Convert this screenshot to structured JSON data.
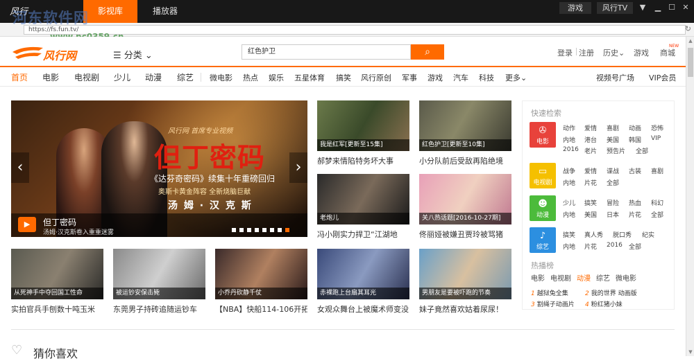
{
  "titlebar": {
    "logo": "风行",
    "tabs": [
      "影视库",
      "播放器"
    ],
    "active_tab": 0,
    "right_buttons": [
      "游戏",
      "风行TV"
    ],
    "controls": [
      "menu-arrow",
      "minimize",
      "maximize",
      "close"
    ]
  },
  "watermark": {
    "text": "河东软件网",
    "url": "www.pc0359.cn"
  },
  "address": {
    "url": "https://fs.fun.tv/"
  },
  "header": {
    "logo_text": "风行网",
    "category_label": "☰ 分类 ⌄",
    "search_value": "红色护卫",
    "search_button": "⌕",
    "links": [
      "登录",
      "注册",
      "历史⌄",
      "游戏",
      "商城"
    ],
    "new_badge": "NEW"
  },
  "nav": {
    "items": [
      "首页",
      "电影",
      "电视剧",
      "少儿",
      "动漫",
      "综艺"
    ],
    "small_items": [
      "微电影",
      "热点",
      "娱乐",
      "五星体育",
      "搞笑",
      "风行原创",
      "军事",
      "游戏",
      "汽车",
      "科技",
      "更多⌄"
    ],
    "right_items": [
      "视频号广场",
      "VIP会员"
    ],
    "active": 0
  },
  "banner": {
    "sub": "风行网 首席专业视频",
    "title": "但丁密码",
    "line1": "《达芬奇密码》续集十年重磅回归",
    "line2": "奥斯卡黄金阵容 全新烧脑巨献",
    "line3": "汤 姆 · 汉 克 斯",
    "caption_title": "但丁密码",
    "caption_sub": "汤姆·汉克斯卷入重重迷雾",
    "dot_count": 8,
    "active_dot": 7,
    "prev": "‹",
    "next": "›"
  },
  "tiles_top": [
    {
      "overlay": "我是红军[更新至15集]",
      "title": "郝梦来情陷特务坏大事"
    },
    {
      "overlay": "红色护卫[更新至10集]",
      "title": "小分队前后受敌再陷绝境"
    },
    {
      "overlay": "老炮儿",
      "title": "冯小刚实力捍卫“江湖地"
    },
    {
      "overlay": "关八热话题[2016-10-27期]",
      "title": "佟丽娅被嫌丑贾玲被骂猪"
    }
  ],
  "tiles_bottom": [
    {
      "overlay": "从死神手中夺回国工性命",
      "title": "实拍官兵手刨数十吨玉米"
    },
    {
      "overlay": "被运钞安保击毙",
      "title": "东莞男子持砖追随运钞车"
    },
    {
      "overlay": "小乔丹砍静千仗",
      "title": "【NBA】快船114-106开拓"
    },
    {
      "overlay": "赤裸跑上台扇其耳光",
      "title": "女观众舞台上被魔术师变没"
    },
    {
      "overlay": "男朋友是要被吓跑的节奏",
      "title": "妹子竟然喜欢姑着尿尿！"
    }
  ],
  "quick_search": {
    "title": "快速检索",
    "groups": [
      {
        "label": "电影",
        "color": "#e8423b",
        "rows": [
          [
            "动作",
            "爱情",
            "喜剧",
            "动画",
            "恐怖"
          ],
          [
            "内地",
            "港台",
            "美国",
            "韩国",
            "VIP"
          ],
          [
            "2016",
            "老片",
            "预告片",
            "全部"
          ]
        ]
      },
      {
        "label": "电视剧",
        "color": "#f5c000",
        "rows": [
          [
            "战争",
            "爱情",
            "谍战",
            "古装",
            "喜剧"
          ],
          [
            "内地",
            "片花",
            "全部"
          ]
        ]
      },
      {
        "label": "动漫",
        "color": "#4cbb3b",
        "rows": [
          [
            "少儿",
            "搞笑",
            "冒险",
            "热血",
            "科幻"
          ],
          [
            "内地",
            "美国",
            "日本",
            "片花",
            "全部"
          ]
        ]
      },
      {
        "label": "综艺",
        "color": "#2c8fe0",
        "rows": [
          [
            "搞笑",
            "真人秀",
            "脱口秀",
            "纪实"
          ],
          [
            "内地",
            "片花",
            "2016",
            "全部"
          ]
        ]
      }
    ]
  },
  "hot": {
    "title": "热播榜",
    "tabs": [
      "电影",
      "电视剧",
      "动漫",
      "综艺",
      "微电影"
    ],
    "active_tab": 2,
    "items": [
      {
        "rank": "1",
        "text": "越狱兔全集"
      },
      {
        "rank": "2",
        "text": "我的世界 动画版"
      },
      {
        "rank": "3",
        "text": "割绳子动画片"
      },
      {
        "rank": "4",
        "text": "粉红猪小妹"
      }
    ]
  },
  "guess": {
    "title": "猜你喜欢"
  },
  "scrollbar": {
    "up": "▲",
    "down": "▼"
  }
}
